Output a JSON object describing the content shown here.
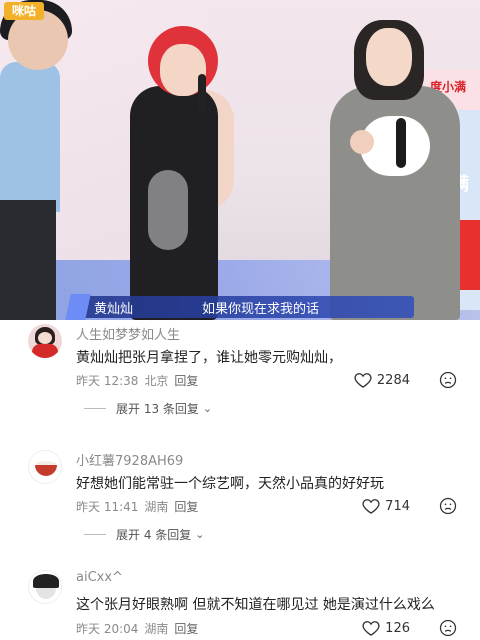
{
  "video": {
    "logo_text": "咪咕",
    "promo_brand": "度小满",
    "promo_brand_short": "满",
    "caption_speaker": "黄灿灿",
    "caption_line": "如果你现在求我的话"
  },
  "comments": [
    {
      "username": "人生如梦梦如人生",
      "text": "黄灿灿把张月拿捏了，谁让她零元购灿灿，",
      "date": "昨天 12:38",
      "location": "北京",
      "reply_label": "回复",
      "likes": "2284",
      "expand_label": "展开 13 条回复"
    },
    {
      "username": "小红薯7928AH69",
      "text": "好想她们能常驻一个综艺啊，天然小品真的好好玩",
      "date": "昨天 11:41",
      "location": "湖南",
      "reply_label": "回复",
      "likes": "714",
      "expand_label": "展开 4 条回复"
    },
    {
      "username": "aiCxx^",
      "text": "这个张月好眼熟啊 但就不知道在哪见过 她是演过什么戏么",
      "date": "昨天 20:04",
      "location": "湖南",
      "reply_label": "回复",
      "likes": "126"
    }
  ],
  "colors": {
    "text": "#222222",
    "meta": "#8a8a8a",
    "caption_bg": "#2f4eb5"
  },
  "icons": {
    "like": "heart-outline-icon",
    "dislike": "frown-face-icon"
  }
}
